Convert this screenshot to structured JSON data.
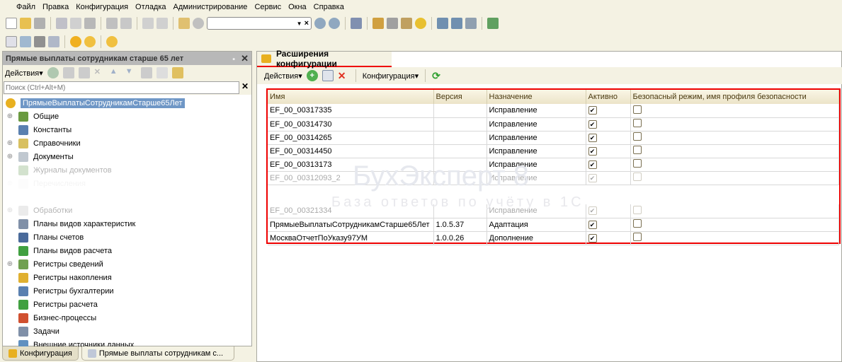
{
  "menu": [
    "Файл",
    "Правка",
    "Конфигурация",
    "Отладка",
    "Администрирование",
    "Сервис",
    "Окна",
    "Справка"
  ],
  "left_panel": {
    "title": "Прямые выплаты сотрудникам старше 65 лет",
    "actions_label": "Действия",
    "search_placeholder": "Поиск (Ctrl+Alt+M)",
    "tree": [
      {
        "label": "ПрямыеВыплатыСотрудникамСтарше65Лет",
        "expand": false,
        "selected": true,
        "color": "#e8b020"
      },
      {
        "label": "Общие",
        "expand": true,
        "color": "#6a9a40"
      },
      {
        "label": "Константы",
        "expand": false,
        "color": "#5a80b0"
      },
      {
        "label": "Справочники",
        "expand": true,
        "color": "#d8c060"
      },
      {
        "label": "Документы",
        "expand": true,
        "color": "#c0c8d0"
      },
      {
        "label": "Журналы документов",
        "expand": false,
        "faded": true,
        "color": "#70a060"
      },
      {
        "label": "Перечисления",
        "expand": true,
        "faded": true,
        "color": "#c0c0c0"
      },
      {
        "label": "",
        "expand": false,
        "hidden": true
      },
      {
        "label": "Обработки",
        "expand": true,
        "faded": true,
        "color": "#c0c0c0"
      },
      {
        "label": "Планы видов характеристик",
        "expand": false,
        "color": "#8090a8"
      },
      {
        "label": "Планы счетов",
        "expand": false,
        "color": "#4a6a9a"
      },
      {
        "label": "Планы видов расчета",
        "expand": false,
        "color": "#40a040"
      },
      {
        "label": "Регистры сведений",
        "expand": true,
        "color": "#70a050"
      },
      {
        "label": "Регистры накопления",
        "expand": false,
        "color": "#e0b030"
      },
      {
        "label": "Регистры бухгалтерии",
        "expand": false,
        "color": "#5a80b0"
      },
      {
        "label": "Регистры расчета",
        "expand": false,
        "color": "#40a040"
      },
      {
        "label": "Бизнес-процессы",
        "expand": false,
        "color": "#d05030"
      },
      {
        "label": "Задачи",
        "expand": false,
        "color": "#8090a8"
      },
      {
        "label": "Внешние источники данных",
        "expand": false,
        "color": "#6090c0"
      }
    ]
  },
  "bottom_tabs": [
    "Конфигурация",
    "Прямые выплаты сотрудникам с..."
  ],
  "main": {
    "title": "Расширения конфигурации",
    "actions_label": "Действия",
    "config_label": "Конфигурация",
    "columns": [
      "Имя",
      "Версия",
      "Назначение",
      "Активно",
      "Безопасный режим, имя профиля безопасности"
    ],
    "rows": [
      {
        "name": "EF_00_00317335",
        "version": "",
        "purpose": "Исправление",
        "active": true,
        "safe": false
      },
      {
        "name": "EF_00_00314730",
        "version": "",
        "purpose": "Исправление",
        "active": true,
        "safe": false
      },
      {
        "name": "EF_00_00314265",
        "version": "",
        "purpose": "Исправление",
        "active": true,
        "safe": false
      },
      {
        "name": "EF_00_00314450",
        "version": "",
        "purpose": "Исправление",
        "active": true,
        "safe": false
      },
      {
        "name": "EF_00_00313173",
        "version": "",
        "purpose": "Исправление",
        "active": true,
        "safe": false
      },
      {
        "name": "EF_00_00312093_2",
        "version": "",
        "purpose": "Исправление",
        "active": true,
        "safe": false,
        "faded": true
      },
      {
        "name": "EF_00_00321334",
        "version": "",
        "purpose": "Исправление",
        "active": true,
        "safe": false,
        "faded": true
      },
      {
        "name": "ПрямыеВыплатыСотрудникамСтарше65Лет",
        "version": "1.0.5.37",
        "purpose": "Адаптация",
        "active": true,
        "safe": false
      },
      {
        "name": "МоскваОтчетПоУказу97УМ",
        "version": "1.0.0.26",
        "purpose": "Дополнение",
        "active": true,
        "safe": false
      }
    ]
  },
  "watermark": {
    "brand": "БухЭксперт 8",
    "tagline": "База ответов по учёту в 1С"
  }
}
